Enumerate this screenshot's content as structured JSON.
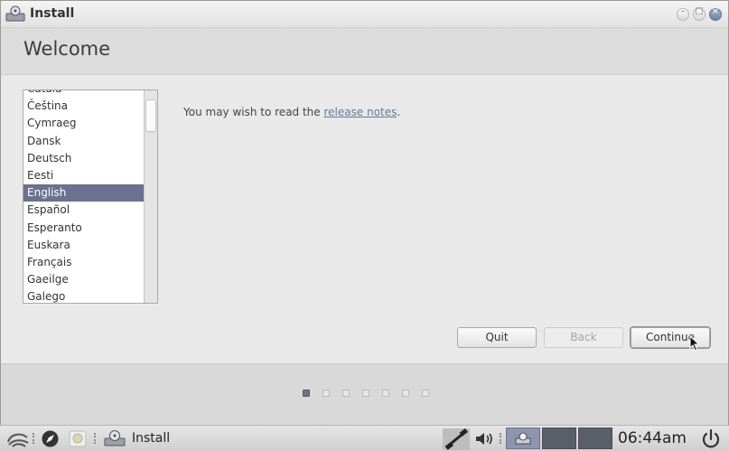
{
  "window": {
    "title": "Install",
    "icon": "installer-drive-icon"
  },
  "header": {
    "title": "Welcome"
  },
  "languages": {
    "items": [
      "Català",
      "Čeština",
      "Cymraeg",
      "Dansk",
      "Deutsch",
      "Eesti",
      "English",
      "Español",
      "Esperanto",
      "Euskara",
      "Français",
      "Gaeilge",
      "Galego"
    ],
    "selected": "English"
  },
  "notes": {
    "prefix": "You may wish to read the ",
    "link": "release notes",
    "suffix": "."
  },
  "buttons": {
    "quit": "Quit",
    "back": "Back",
    "continue": "Continue"
  },
  "steps": {
    "total": 7,
    "current": 1
  },
  "taskbar": {
    "task_label": "Install",
    "clock": "06:44am"
  },
  "colors": {
    "selection": "#6a7290",
    "link": "#5e7a9e",
    "active_step": "#6b7287"
  }
}
